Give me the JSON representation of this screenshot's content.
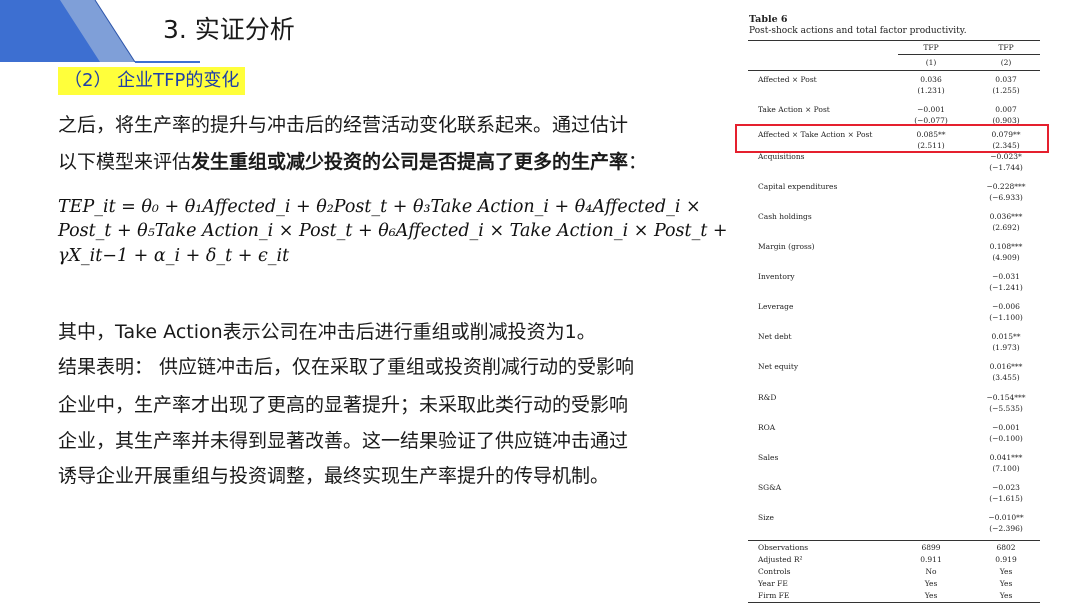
{
  "header": {
    "title": "3. 实证分析",
    "subheading": "（2） 企业TFP的变化"
  },
  "text": {
    "intro_line1": "之后，将生产率的提升与冲击后的经营活动变化联系起来。通过估计",
    "intro_line2_plain": "以下模型来评估",
    "intro_line2_bold": "发生重组或减少投资的公司是否提高了更多的生产率",
    "intro_line2_end": "：",
    "formula_line1": "TEP_it = θ₀ + θ₁Affected_i + θ₂Post_t + θ₃Take Action_i + θ₄Affected_i ×",
    "formula_line2": "Post_t + θ₅Take Action_i × Post_t + θ₆Affected_i × Take Action_i × Post_t +",
    "formula_line3": "γX_it−1 + α_i + δ_t + ϵ_it",
    "note": "其中，Take Action表示公司在冲击后进行重组或削减投资为1。",
    "result_line1": "结果表明： 供应链冲击后，仅在采取了重组或投资削减行动的受影响",
    "result_line2": "企业中，生产率才出现了更高的显著提升；未采取此类行动的受影响",
    "result_line3": "企业，其生产率并未得到显著改善。这一结果验证了供应链冲击通过",
    "result_line4": "诱导企业开展重组与投资调整，最终实现生产率提升的传导机制。"
  },
  "table": {
    "title": "Table 6",
    "caption": "Post-shock actions and total factor productivity.",
    "header_top": [
      "TFP",
      "TFP"
    ],
    "header_num": [
      "(1)",
      "(2)"
    ],
    "rows": [
      {
        "label": "Affected × Post",
        "c1": "0.036",
        "c1se": "(1.231)",
        "c2": "0.037",
        "c2se": "(1.255)"
      },
      {
        "label": "Take Action × Post",
        "c1": "−0.001",
        "c1se": "(−0.077)",
        "c2": "0.007",
        "c2se": "(0.903)"
      },
      {
        "label": "Affected × Take Action × Post",
        "c1": "0.085**",
        "c1se": "(2.511)",
        "c2": "0.079**",
        "c2se": "(2.345)"
      },
      {
        "label": "Acquisitions",
        "c1": "",
        "c1se": "",
        "c2": "−0.023*",
        "c2se": "(−1.744)"
      },
      {
        "label": "Capital expenditures",
        "c1": "",
        "c1se": "",
        "c2": "−0.228***",
        "c2se": "(−6.933)"
      },
      {
        "label": "Cash holdings",
        "c1": "",
        "c1se": "",
        "c2": "0.036***",
        "c2se": "(2.692)"
      },
      {
        "label": "Margin (gross)",
        "c1": "",
        "c1se": "",
        "c2": "0.108***",
        "c2se": "(4.909)"
      },
      {
        "label": "Inventory",
        "c1": "",
        "c1se": "",
        "c2": "−0.031",
        "c2se": "(−1.241)"
      },
      {
        "label": "Leverage",
        "c1": "",
        "c1se": "",
        "c2": "−0.006",
        "c2se": "(−1.100)"
      },
      {
        "label": "Net debt",
        "c1": "",
        "c1se": "",
        "c2": "0.015**",
        "c2se": "(1.973)"
      },
      {
        "label": "Net equity",
        "c1": "",
        "c1se": "",
        "c2": "0.016***",
        "c2se": "(3.455)"
      },
      {
        "label": "R&D",
        "c1": "",
        "c1se": "",
        "c2": "−0.154***",
        "c2se": "(−5.535)"
      },
      {
        "label": "ROA",
        "c1": "",
        "c1se": "",
        "c2": "−0.001",
        "c2se": "(−0.100)"
      },
      {
        "label": "Sales",
        "c1": "",
        "c1se": "",
        "c2": "0.041***",
        "c2se": "(7.100)"
      },
      {
        "label": "SG&A",
        "c1": "",
        "c1se": "",
        "c2": "−0.023",
        "c2se": "(−1.615)"
      },
      {
        "label": "Size",
        "c1": "",
        "c1se": "",
        "c2": "−0.010**",
        "c2se": "(−2.396)"
      }
    ],
    "stats": [
      {
        "label": "Observations",
        "c1": "6899",
        "c2": "6802"
      },
      {
        "label": "Adjusted R²",
        "c1": "0.911",
        "c2": "0.919"
      },
      {
        "label": "Controls",
        "c1": "No",
        "c2": "Yes"
      },
      {
        "label": "Year FE",
        "c1": "Yes",
        "c2": "Yes"
      },
      {
        "label": "Firm FE",
        "c1": "Yes",
        "c2": "Yes"
      }
    ]
  },
  "colors": {
    "accent_blue": "#3d6fd1",
    "highlight_yellow": "#ffff3b",
    "box_red": "#e5202e",
    "subheading_text": "#1f3fa8"
  }
}
